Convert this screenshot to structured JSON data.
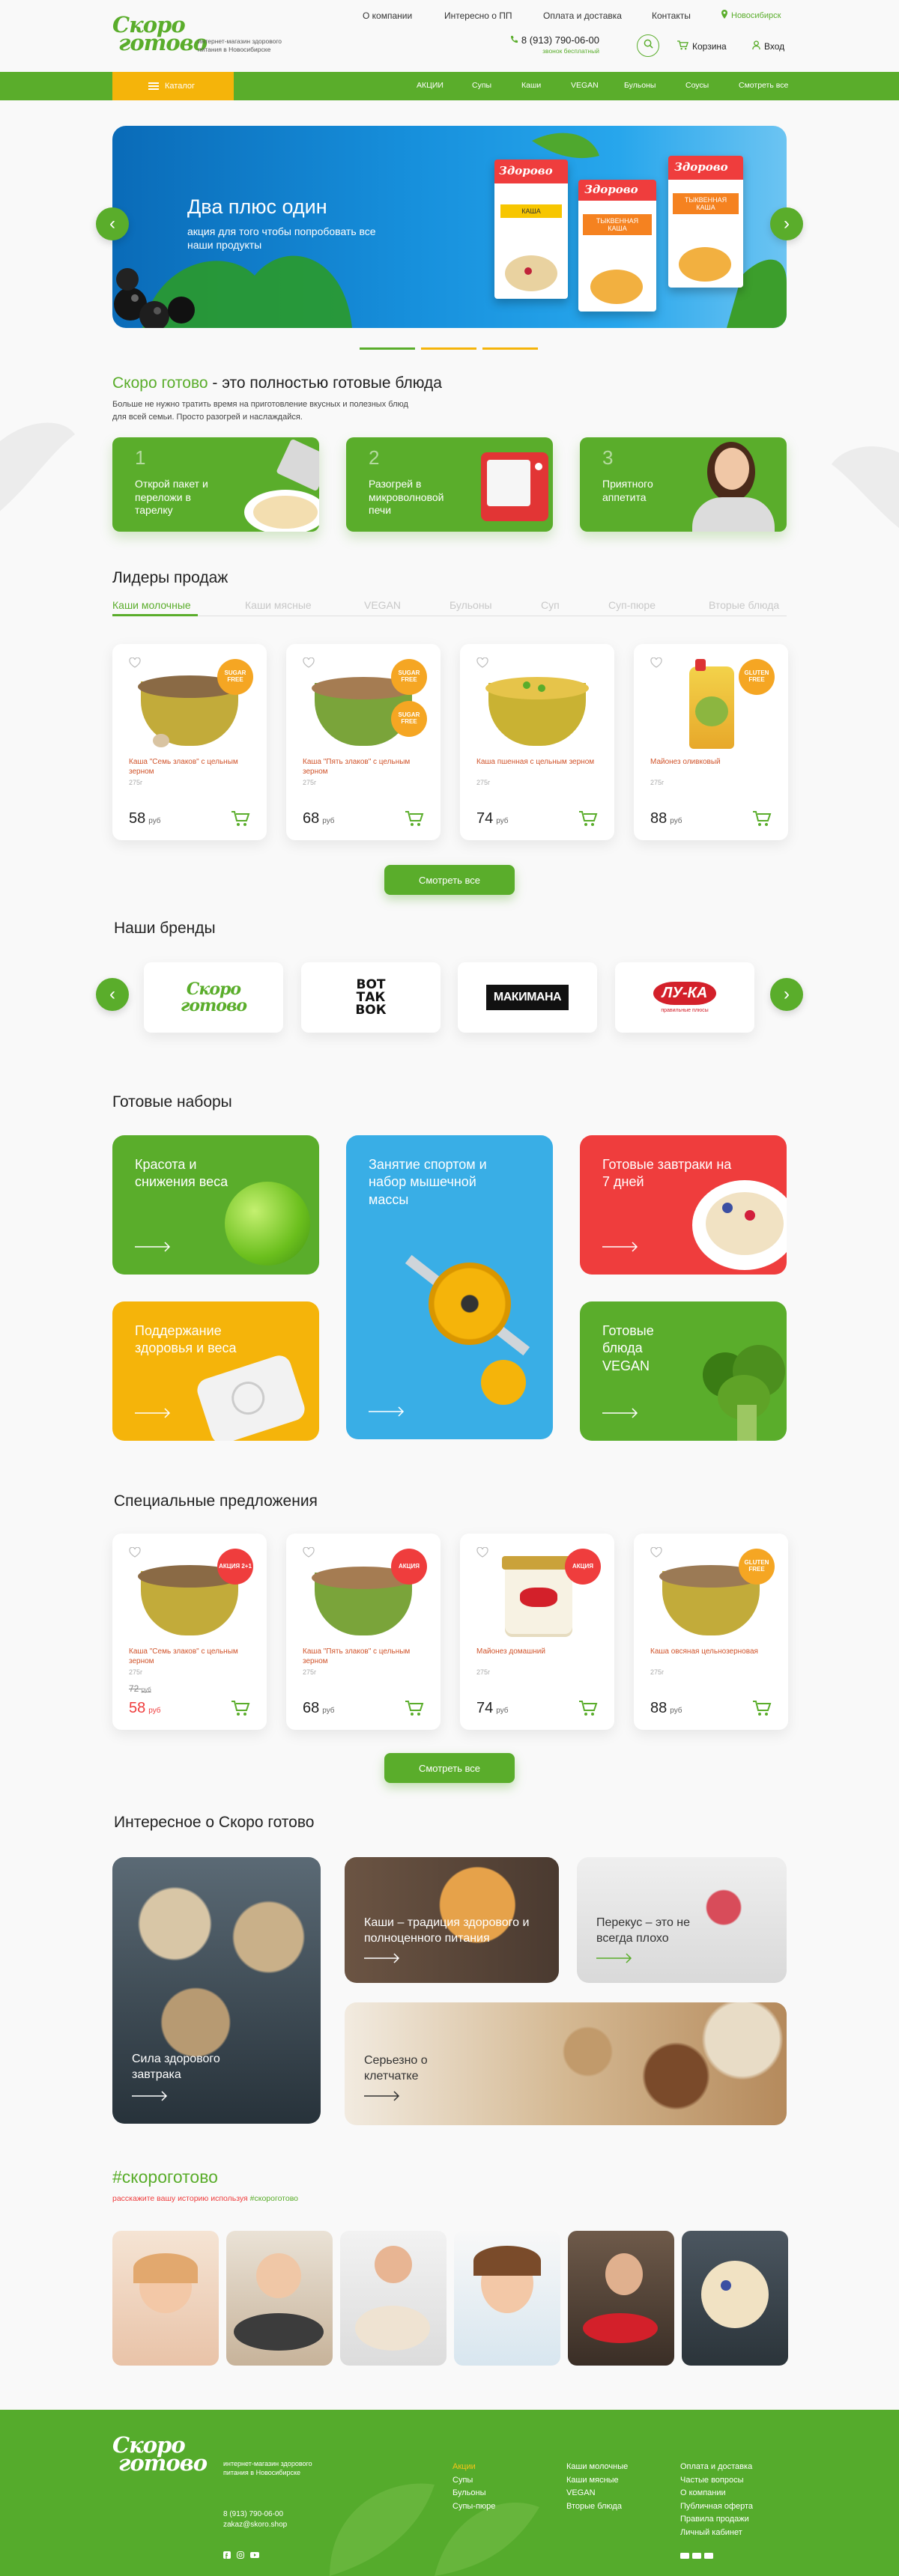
{
  "header": {
    "logo": [
      "Скоро",
      "готово"
    ],
    "tagline": "интернет-магазин здорового питания в Новосибирске",
    "links": [
      "О компании",
      "Интересно о ПП",
      "Оплата и доставка",
      "Контакты"
    ],
    "city": "Новосибирск",
    "phone": "8 (913) 790-06-00",
    "phone_note": "звонок бесплатный",
    "cart": "Корзина",
    "login": "Вход"
  },
  "nav": {
    "catalog": "Каталог",
    "items": [
      "АКЦИИ",
      "Супы",
      "Каши",
      "VEGAN",
      "Бульоны",
      "Соусы",
      "Смотреть все"
    ]
  },
  "banner": {
    "title": "Два плюс один",
    "subtitle": "акция для того чтобы попробовать все наши продукты",
    "box_brand": "Здорово",
    "box_labels": [
      "КАША",
      "ТЫКВЕННАЯ КАША",
      "ТЫКВЕННАЯ КАША"
    ]
  },
  "intro": {
    "brand": "Скоро готово",
    "title_rest": " - это полностью готовые блюда",
    "text": "Больше не нужно тратить время на приготовление вкусных и полезных блюд для всей семьи. Просто разогрей и наслаждайся.",
    "steps": [
      {
        "num": "1",
        "text": "Открой пакет и переложи в тарелку"
      },
      {
        "num": "2",
        "text": "Разогрей в микроволновой печи"
      },
      {
        "num": "3",
        "text": "Приятного аппетита"
      }
    ]
  },
  "leaders": {
    "title": "Лидеры продаж",
    "tabs": [
      "Каши молочные",
      "Каши мясные",
      "VEGAN",
      "Бульоны",
      "Суп",
      "Суп-пюре",
      "Вторые блюда"
    ],
    "currency": "руб",
    "products": [
      {
        "name": "Каша \"Семь злаков\" с цельным зерном",
        "weight": "275г",
        "price": "58",
        "badges": [
          "SUGAR FREE"
        ]
      },
      {
        "name": "Каша \"Пять злаков\" с цельным зерном",
        "weight": "275г",
        "price": "68",
        "badges": [
          "SUGAR FREE",
          "SUGAR FREE"
        ]
      },
      {
        "name": "Каша пшенная с цельным зерном",
        "weight": "275г",
        "price": "74",
        "badges": []
      },
      {
        "name": "Майонез оливковый",
        "weight": "275г",
        "price": "88",
        "badges": [
          "GLUTEN FREE"
        ]
      }
    ],
    "button": "Смотреть все"
  },
  "brands": {
    "title": "Наши бренды",
    "items": [
      {
        "name": "Скоро готово"
      },
      {
        "name": "ВОТ ТАК ВОК"
      },
      {
        "name": "МАКИМАНА"
      },
      {
        "name": "ЛУ-КА",
        "sub": "правильные плюсы"
      }
    ]
  },
  "sets": {
    "title": "Готовые наборы",
    "items": [
      {
        "title": "Красота и снижения веса",
        "color": "#5aad2b"
      },
      {
        "title": "Занятие спортом и набор мышечной массы",
        "color": "#39aee6"
      },
      {
        "title": "Готовые завтраки на 7 дней",
        "color": "#ef3d3d"
      },
      {
        "title": "Поддержание здоровья и веса",
        "color": "#f5b40a"
      },
      {
        "title": "Готовые блюда VEGAN",
        "color": "#5aad2b"
      }
    ]
  },
  "special": {
    "title": "Специальные предложения",
    "currency": "руб",
    "products": [
      {
        "name": "Каша \"Семь злаков\" с цельным зерном",
        "weight": "275г",
        "price": "58",
        "old": "72",
        "old_unit": "руб",
        "badge": "АКЦИЯ 2+1"
      },
      {
        "name": "Каша \"Пять злаков\" с цельным зерном",
        "weight": "275г",
        "price": "68",
        "badge": "АКЦИЯ"
      },
      {
        "name": "Майонез домашний",
        "weight": "275г",
        "price": "74",
        "badge": "АКЦИЯ"
      },
      {
        "name": "Каша овсяная цельнозерновая",
        "weight": "275г",
        "price": "88",
        "badge": "GLUTEN FREE"
      }
    ],
    "button": "Смотреть все"
  },
  "blog": {
    "title": "Интересное о Скоро готово",
    "items": [
      {
        "title": "Сила здорового завтрака"
      },
      {
        "title": "Каши – традиция здорового и полноценного питания"
      },
      {
        "title": "Перекус – это не всегда плохо"
      },
      {
        "title": "Серьезно о клетчатке"
      }
    ]
  },
  "ugc": {
    "hashtag": "#скороготово",
    "text": "расскажите вашу историю используя ",
    "tag": "#скороготово"
  },
  "footer": {
    "tagline": "интернет-магазин здорового питания в Новосибирске",
    "phone": "8 (913) 790-06-00",
    "email": "zakaz@skoro.shop",
    "col1": [
      "Акции",
      "Супы",
      "Бульоны",
      "Супы-пюре"
    ],
    "col2": [
      "Каши молочные",
      "Каши мясные",
      "VEGAN",
      "Вторые блюда"
    ],
    "col3": [
      "Оплата и доставка",
      "Частые вопросы",
      "О компании",
      "Публичная оферта",
      "Правила продажи",
      "Личный кабинет"
    ]
  },
  "colors": {
    "green": "#5aad2b",
    "orange": "#f5b40a",
    "red": "#ef3d3d",
    "blue": "#39aee6"
  }
}
